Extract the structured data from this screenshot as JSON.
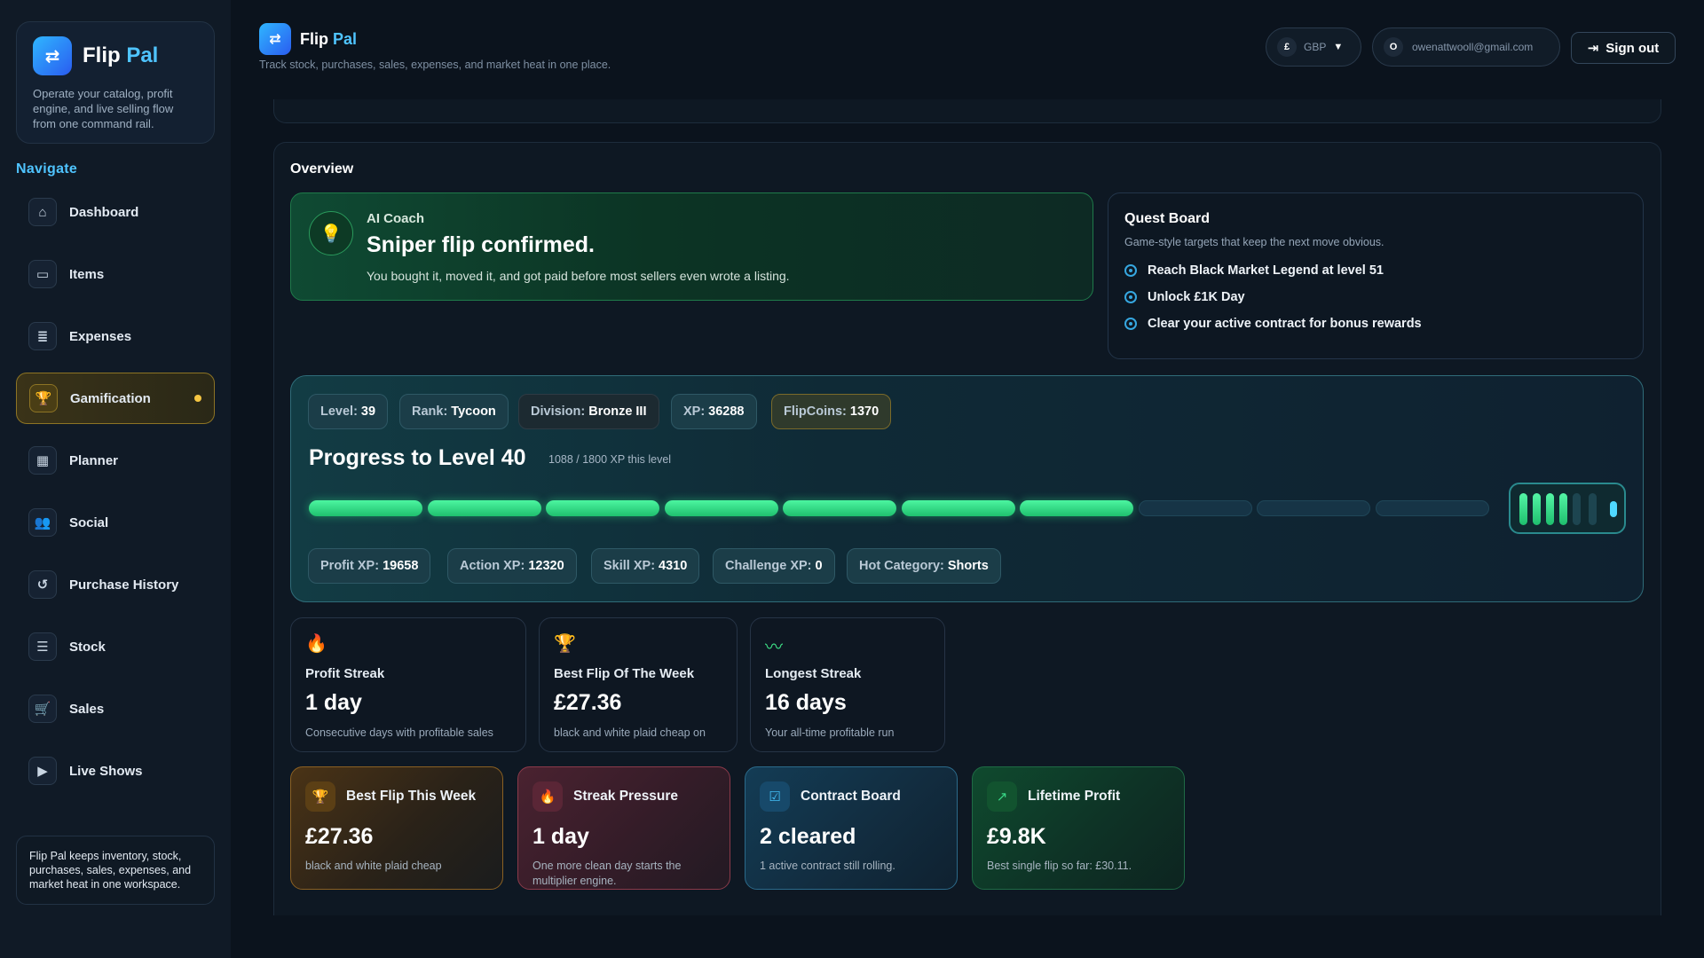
{
  "app": {
    "name_main": "Flip",
    "name_accent": "Pal",
    "tagline": "Operate your catalog, profit engine, and live selling flow from one command rail.",
    "header_subtitle": "Track stock, purchases, sales, expenses, and market heat in one place."
  },
  "sidebar": {
    "nav_title": "Navigate",
    "items": [
      {
        "label": "Dashboard",
        "icon": "home-icon"
      },
      {
        "label": "Items",
        "icon": "box-icon"
      },
      {
        "label": "Expenses",
        "icon": "receipt-icon"
      },
      {
        "label": "Gamification",
        "icon": "trophy-icon",
        "active": true
      },
      {
        "label": "Planner",
        "icon": "calendar-icon"
      },
      {
        "label": "Social",
        "icon": "people-icon"
      },
      {
        "label": "Purchase History",
        "icon": "history-icon"
      },
      {
        "label": "Stock",
        "icon": "stack-icon"
      },
      {
        "label": "Sales",
        "icon": "cart-icon"
      },
      {
        "label": "Live Shows",
        "icon": "video-icon"
      }
    ],
    "footer_text": "Flip Pal keeps inventory, stock, purchases, sales, expenses, and market heat in one workspace."
  },
  "header": {
    "currency_symbol": "£",
    "currency": "GBP",
    "avatar_initial": "O",
    "email": "owenattwooll@gmail.com",
    "signout_label": "Sign out"
  },
  "overview": {
    "title": "Overview",
    "coach": {
      "kicker": "AI Coach",
      "headline": "Sniper flip confirmed.",
      "text": "You bought it, moved it, and got paid before most sellers even wrote a listing."
    },
    "quest": {
      "title": "Quest Board",
      "subtitle": "Game-style targets that keep the next move obvious.",
      "items": [
        "Reach Black Market Legend at level 51",
        "Unlock £1K Day",
        "Clear your active contract for bonus rewards"
      ]
    },
    "progress": {
      "chips_top": [
        {
          "k": "Level:",
          "v": "39"
        },
        {
          "k": "Rank:",
          "v": "Tycoon"
        },
        {
          "k": "Division:",
          "v": "Bronze III"
        },
        {
          "k": "XP:",
          "v": "36288"
        },
        {
          "k": "FlipCoins:",
          "v": "1370"
        }
      ],
      "title": "Progress to Level 40",
      "subtitle": "1088 / 1800 XP this level",
      "segments_filled": 7,
      "segments_total": 10,
      "chips_bottom": [
        {
          "k": "Profit XP:",
          "v": "19658"
        },
        {
          "k": "Action XP:",
          "v": "12320"
        },
        {
          "k": "Skill XP:",
          "v": "4310"
        },
        {
          "k": "Challenge XP:",
          "v": "0"
        },
        {
          "k": "Hot Category:",
          "v": "Shorts"
        }
      ]
    },
    "stats": [
      {
        "icon": "flame-icon",
        "label": "Profit Streak",
        "value": "1 day",
        "note": "Consecutive days with profitable sales"
      },
      {
        "icon": "trophy-icon",
        "label": "Best Flip Of The Week",
        "value": "£27.36",
        "note": "black and white plaid cheap on"
      },
      {
        "icon": "trend-icon",
        "label": "Longest Streak",
        "value": "16 days",
        "note": "Your all-time profitable run"
      }
    ],
    "mini": [
      {
        "icon": "trophy-icon",
        "title": "Best Flip This Week",
        "value": "£27.36",
        "note": "black and white plaid cheap"
      },
      {
        "icon": "flame-icon",
        "title": "Streak Pressure",
        "value": "1 day",
        "note": "One more clean day starts the multiplier engine."
      },
      {
        "icon": "checkbox-icon",
        "title": "Contract Board",
        "value": "2 cleared",
        "note": "1 active contract still rolling."
      },
      {
        "icon": "trend-icon",
        "title": "Lifetime Profit",
        "value": "£9.8K",
        "note": "Best single flip so far: £30.11."
      }
    ]
  }
}
